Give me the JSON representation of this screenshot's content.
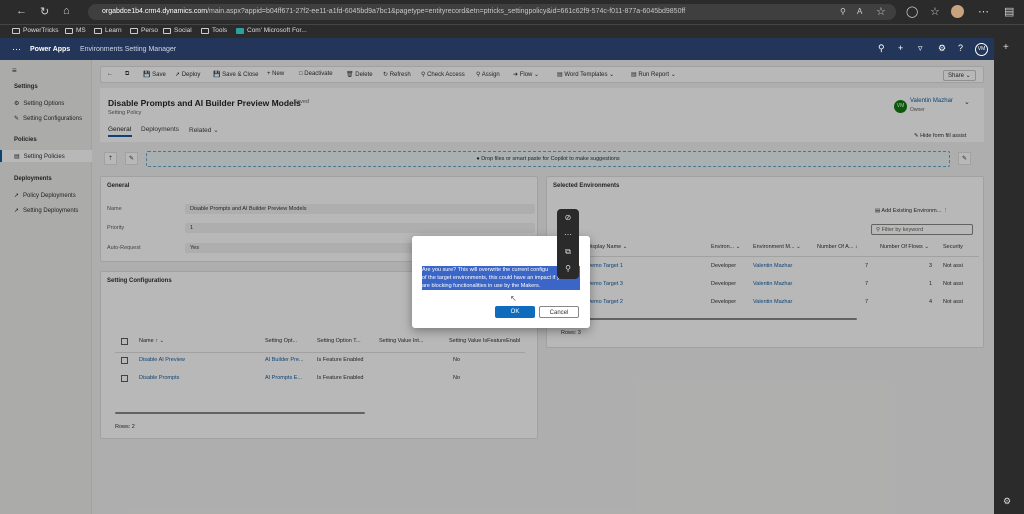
{
  "browser": {
    "url_host": "orgabdce1b4.crm4.dynamics.com",
    "url_rest": "/main.aspx?appid=b04ff671-27f2-ee11-a1fd-6045bd9a7bc1&pagetype=entityrecord&etn=ptricks_settingpolicy&id=661c62f9-574c-f011-877a-6045bd9850ff",
    "bookmarks": [
      "PowerTricks",
      "MS",
      "Learn",
      "Perso",
      "Social",
      "Tools",
      "Com' Microsoft For..."
    ]
  },
  "app": {
    "name": "Power Apps",
    "title": "Environments Setting Manager",
    "avatar": "VM"
  },
  "sidebar": {
    "sections": [
      {
        "header": "Settings",
        "items": [
          "Setting Options",
          "Setting Configurations"
        ]
      },
      {
        "header": "Policies",
        "items": [
          "Setting Policies"
        ]
      },
      {
        "header": "Deployments",
        "items": [
          "Policy Deployments",
          "Setting Deployments"
        ]
      }
    ]
  },
  "command": {
    "items": [
      "Save",
      "Deploy",
      "Save & Close",
      "New",
      "Deactivate",
      "Delete",
      "Refresh",
      "Check Access",
      "Assign",
      "Flow",
      "Word Templates",
      "Run Report"
    ],
    "share": "Share"
  },
  "record": {
    "title": "Disable Prompts and AI Builder Preview Models",
    "saved": "- Saved",
    "type": "Setting Policy",
    "owner_name": "Valentin Mazhar",
    "owner_role": "Owner",
    "owner_initials": "VM",
    "tabs": [
      "General",
      "Deployments",
      "Related"
    ],
    "hide_form_fill": "Hide form fill assist"
  },
  "copilot": {
    "drop": "Drop files or smart paste for Copilot to make suggestions"
  },
  "general": {
    "title": "General",
    "fields": [
      {
        "label": "Name",
        "value": "Disable Prompts and AI Builder Preview Models"
      },
      {
        "label": "Priority",
        "value": "1"
      },
      {
        "label": "Auto-Request",
        "value": "Yes"
      }
    ]
  },
  "setting_configs": {
    "title": "Setting Configurations",
    "headers": [
      "Name",
      "Setting Opt...",
      "Setting Option T...",
      "Setting Value Int...",
      "Setting Value IsFeatureEnabl"
    ],
    "rows": [
      [
        "Disable AI Preview",
        "AI Builder Pre...",
        "Is Feature Enabled",
        "",
        "No"
      ],
      [
        "Disable Prompts",
        "AI Prompts E...",
        "Is Feature Enabled",
        "",
        "No"
      ]
    ],
    "footer": "Rows: 2"
  },
  "selected_envs": {
    "title": "Selected Environments",
    "add": "Add Existing Environm...",
    "filter_placeholder": "Filter by keyword",
    "headers": [
      "Display Name",
      "Environ...",
      "Environment M...",
      "Number Of A...",
      "Number Of Flows",
      "Security"
    ],
    "rows": [
      [
        "Demo Target 1",
        "Developer",
        "Valentin Mazhar",
        "7",
        "3",
        "Not assi"
      ],
      [
        "Demo Target 3",
        "Developer",
        "Valentin Mazhar",
        "7",
        "1",
        "Not assi"
      ],
      [
        "Demo Target 2",
        "Developer",
        "Valentin Mazhar",
        "7",
        "4",
        "Not assi"
      ]
    ],
    "footer": "Rows: 3"
  },
  "dialog": {
    "line1": "Are you sure? This will overwrite the current configu",
    "line2": "of the target environments, this could have an impact if you",
    "line3": "are blocking functionalities in use by the Makers.",
    "ok": "OK",
    "cancel": "Cancel"
  }
}
